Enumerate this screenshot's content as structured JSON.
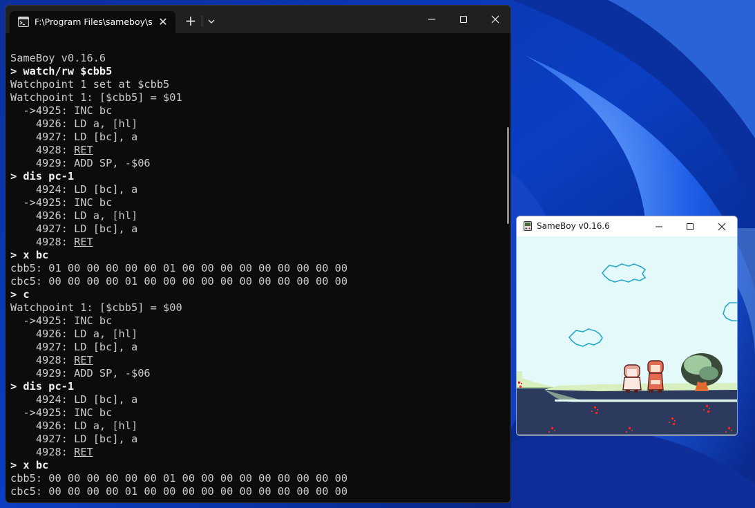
{
  "terminal": {
    "tab_title": "F:\\Program Files\\sameboy\\sameboy_debugger.exe",
    "new_tab_symbol": "+",
    "close_symbol": "✕",
    "lines": [
      [
        {
          "t": "SameBoy v0.16.6"
        }
      ],
      [
        {
          "t": "> watch/rw $cbb5",
          "c": "cmd"
        }
      ],
      [
        {
          "t": "Watchpoint 1 set at $cbb5"
        }
      ],
      [
        {
          "t": "Watchpoint 1: [$cbb5] = $01"
        }
      ],
      [
        {
          "t": "  ->4925: INC bc"
        }
      ],
      [
        {
          "t": "    4926: LD a, [hl]"
        }
      ],
      [
        {
          "t": "    4927: LD [bc], a"
        }
      ],
      [
        {
          "t": "    4928: "
        },
        {
          "t": "RET",
          "c": "u"
        }
      ],
      [
        {
          "t": "    4929: ADD SP, -$06"
        }
      ],
      [
        {
          "t": "> dis pc-1",
          "c": "cmd"
        }
      ],
      [
        {
          "t": "    4924: LD [bc], a"
        }
      ],
      [
        {
          "t": "  ->4925: INC bc"
        }
      ],
      [
        {
          "t": "    4926: LD a, [hl]"
        }
      ],
      [
        {
          "t": "    4927: LD [bc], a"
        }
      ],
      [
        {
          "t": "    4928: "
        },
        {
          "t": "RET",
          "c": "u"
        }
      ],
      [
        {
          "t": "> x bc",
          "c": "cmd"
        }
      ],
      [
        {
          "t": "cbb5: 01 00 00 00 00 00 01 00 00 00 00 00 00 00 00 00"
        }
      ],
      [
        {
          "t": "cbc5: 00 00 00 00 01 00 00 00 00 00 00 00 00 00 00 00"
        }
      ],
      [
        {
          "t": "> c",
          "c": "cmd"
        }
      ],
      [
        {
          "t": "Watchpoint 1: [$cbb5] = $00"
        }
      ],
      [
        {
          "t": "  ->4925: INC bc"
        }
      ],
      [
        {
          "t": "    4926: LD a, [hl]"
        }
      ],
      [
        {
          "t": "    4927: LD [bc], a"
        }
      ],
      [
        {
          "t": "    4928: "
        },
        {
          "t": "RET",
          "c": "u"
        }
      ],
      [
        {
          "t": "    4929: ADD SP, -$06"
        }
      ],
      [
        {
          "t": "> dis pc-1",
          "c": "cmd"
        }
      ],
      [
        {
          "t": "    4924: LD [bc], a"
        }
      ],
      [
        {
          "t": "  ->4925: INC bc"
        }
      ],
      [
        {
          "t": "    4926: LD a, [hl]"
        }
      ],
      [
        {
          "t": "    4927: LD [bc], a"
        }
      ],
      [
        {
          "t": "    4928: "
        },
        {
          "t": "RET",
          "c": "u"
        }
      ],
      [
        {
          "t": "> x bc",
          "c": "cmd"
        }
      ],
      [
        {
          "t": "cbb5: 00 00 00 00 00 00 01 00 00 00 00 00 00 00 00 00"
        }
      ],
      [
        {
          "t": "cbc5: 00 00 00 00 01 00 00 00 00 00 00 00 00 00 00 00"
        }
      ]
    ]
  },
  "sameboy": {
    "title": "SameBoy v0.16.6"
  },
  "icons": {
    "terminal_tab": "terminal-app-icon",
    "dropdown": "chevron-down-icon",
    "minimize": "minimize-icon",
    "maximize": "maximize-icon",
    "close": "close-icon",
    "sameboy_app": "gameboy-icon"
  },
  "colors": {
    "terminal_bg": "#0c0c0c",
    "terminal_text": "#cccccc",
    "gb_sky": "#e4fafa",
    "gb_ground": "#2c3a5e",
    "gb_grass": "#d8f0c0",
    "gb_flower": "#e03030"
  }
}
